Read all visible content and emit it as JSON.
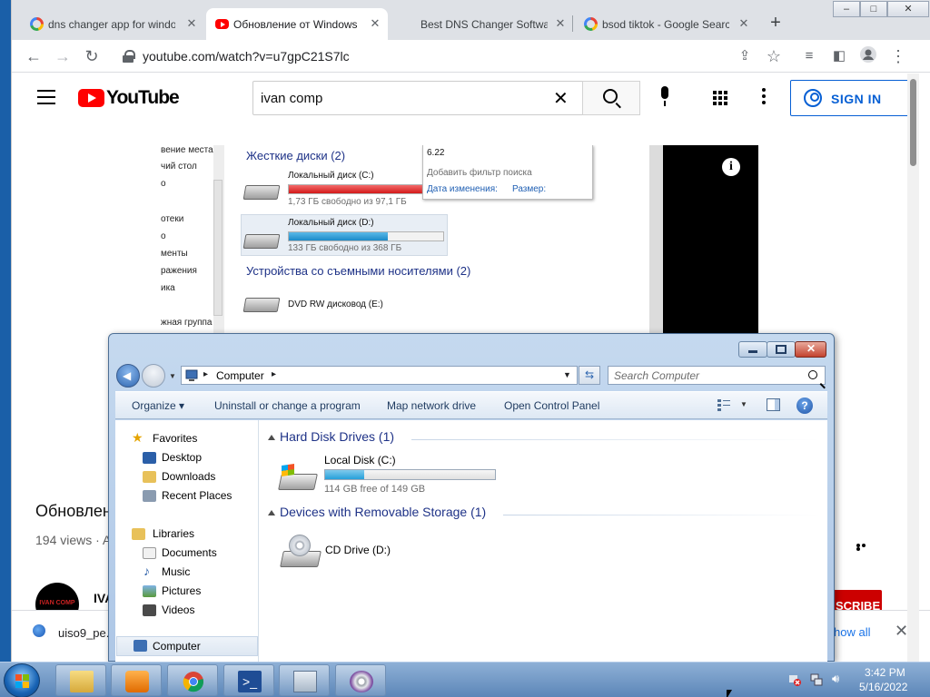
{
  "browser": {
    "tabs": [
      {
        "label": "dns changer app for windows",
        "icon": "google-icon"
      },
      {
        "label": "Обновление от Windows",
        "icon": "youtube-icon"
      },
      {
        "label": "Best DNS Changer Software",
        "icon": "none"
      },
      {
        "label": "bsod tiktok - Google Search",
        "icon": "google-icon"
      }
    ],
    "url": "youtube.com/watch?v=u7gpC21S7lc",
    "window_controls": {
      "minimize": "–",
      "maximize": "□",
      "close": "✕"
    }
  },
  "youtube": {
    "logo_text": "YouTube",
    "search_value": "ivan comp",
    "sign_in_label": "SIGN IN",
    "video_title": "Обновлен",
    "views_text": "194 views · A",
    "channel_name": "IVA",
    "channel_avatar_text": "IVAN COMP",
    "subscribe_label": "SCRIBE",
    "accent_color": "#ff0000",
    "video_frame": {
      "left_nav": [
        "вение места",
        "чий стол",
        "о",
        "отеки",
        "о",
        "менты",
        "ражения",
        "ика",
        "жная группа"
      ],
      "section_hdd": "Жесткие диски (2)",
      "drive_c_name": "Локальный диск (C:)",
      "drive_c_free": "1,73 ГБ свободно из 97,1 ГБ",
      "drive_c_fill": 0.98,
      "drive_d_name": "Локальный диск (D:)",
      "drive_d_free": "133 ГБ свободно из 368 ГБ",
      "drive_d_fill": 0.64,
      "section_removable": "Устройства со съемными носителями (2)",
      "dvd_name": "DVD RW дисковод (E:)",
      "popup_value": "6.22",
      "popup_hint": "Добавить фильтр поиска",
      "popup_link1": "Дата изменения:",
      "popup_link2": "Размер:"
    }
  },
  "download_bar": {
    "filename": "uiso9_pe.e",
    "show_all": "how all"
  },
  "explorer": {
    "address": "Computer",
    "search_placeholder": "Search Computer",
    "commands": [
      "Organize ▾",
      "Uninstall or change a program",
      "Map network drive",
      "Open Control Panel"
    ],
    "nav": {
      "favorites": "Favorites",
      "desktop": "Desktop",
      "downloads": "Downloads",
      "recent": "Recent Places",
      "libraries": "Libraries",
      "documents": "Documents",
      "music": "Music",
      "pictures": "Pictures",
      "videos": "Videos",
      "computer": "Computer"
    },
    "section_hdd": "Hard Disk Drives (1)",
    "local_disk_name": "Local Disk (C:)",
    "local_disk_free": "114 GB free of 149 GB",
    "local_disk_used_fraction": 0.23,
    "section_removable": "Devices with Removable Storage (1)",
    "cd_drive_name": "CD Drive (D:)"
  },
  "taskbar": {
    "time": "3:42 PM",
    "date": "5/16/2022"
  }
}
